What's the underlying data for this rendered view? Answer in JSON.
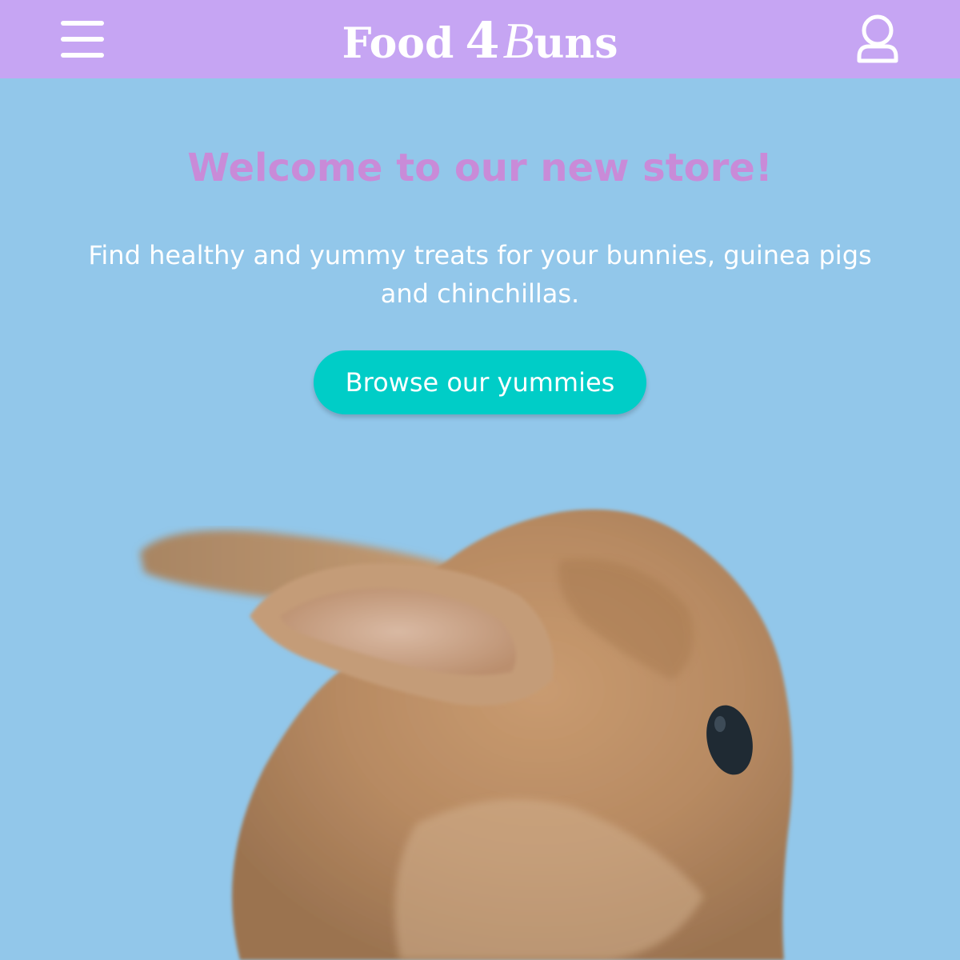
{
  "header": {
    "logo": {
      "word1": "Food",
      "number": "4",
      "word2_initial": "B",
      "word2_rest": "uns"
    },
    "menu_icon": "hamburger-menu-icon",
    "account_icon": "user-account-icon"
  },
  "hero": {
    "title": "Welcome to our new store!",
    "subtitle": "Find healthy and yummy treats for your bunnies, guinea pigs and chinchillas.",
    "cta_label": "Browse our yummies"
  },
  "colors": {
    "header_bg": "#c6a5f3",
    "page_bg": "#92c7ea",
    "title": "#c98bd8",
    "cta_bg": "#00cdc7",
    "text": "#ffffff"
  }
}
